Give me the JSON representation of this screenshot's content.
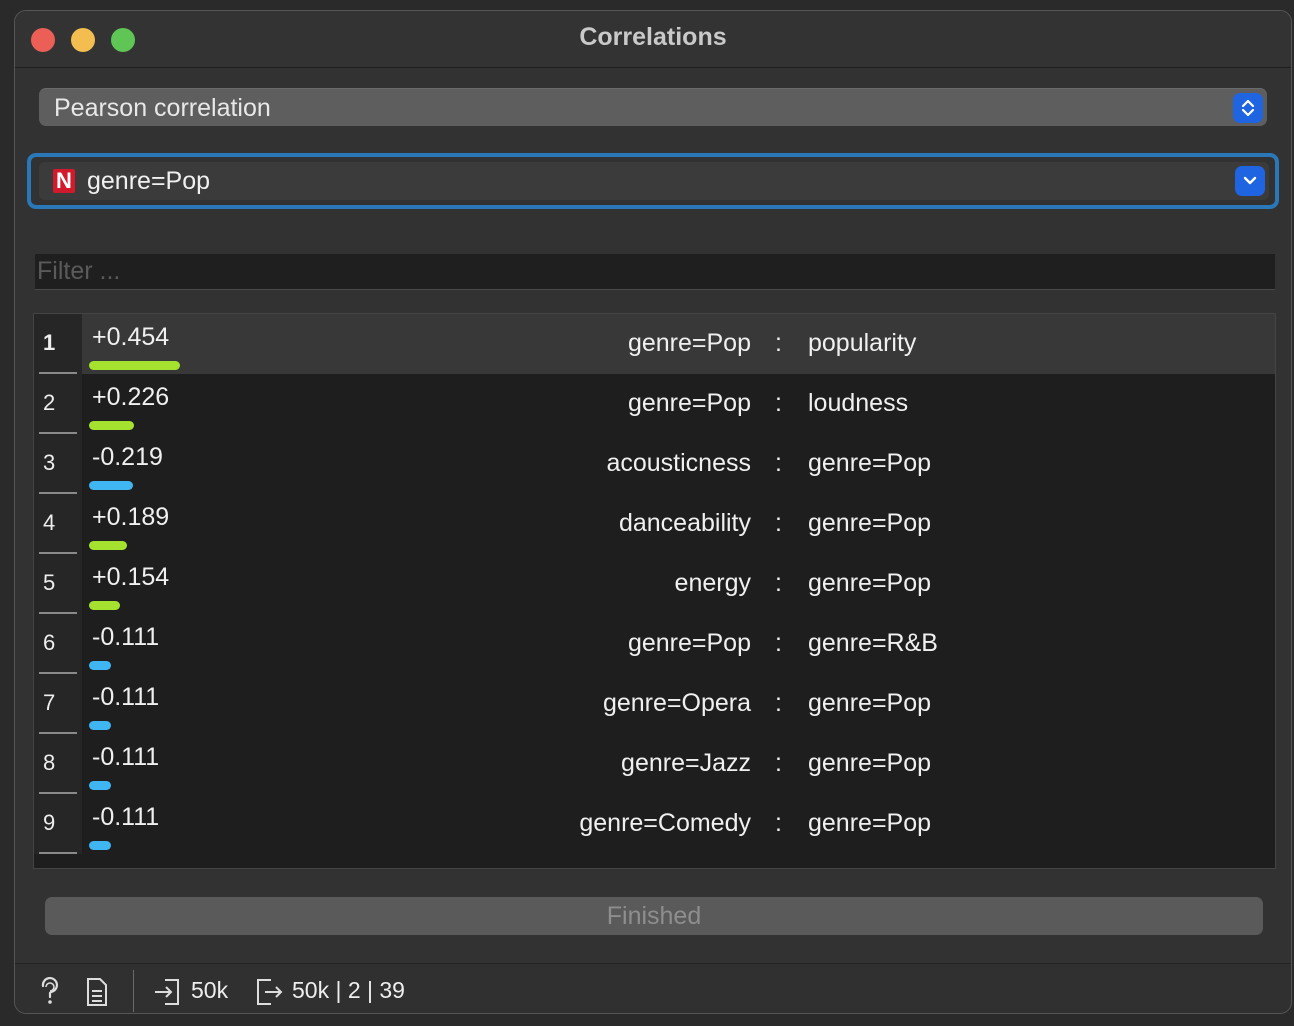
{
  "window": {
    "title": "Correlations"
  },
  "method": {
    "selected": "Pearson correlation"
  },
  "feature": {
    "type_badge": "N",
    "selected": "genre=Pop"
  },
  "filter": {
    "placeholder": "Filter ...",
    "value": ""
  },
  "colors": {
    "positive_bar": "#a4e22f",
    "negative_bar": "#3fb6f2",
    "accent": "#1f64e0",
    "focus_ring": "#2a78b8",
    "badge": "#d11b2c"
  },
  "table": {
    "rows": [
      {
        "index": "1",
        "value": 0.454,
        "value_text": "+0.454",
        "attr1": "genre=Pop",
        "sep": ":",
        "attr2": "popularity",
        "selected": true
      },
      {
        "index": "2",
        "value": 0.226,
        "value_text": "+0.226",
        "attr1": "genre=Pop",
        "sep": ":",
        "attr2": "loudness"
      },
      {
        "index": "3",
        "value": -0.219,
        "value_text": "-0.219",
        "attr1": "acousticness",
        "sep": ":",
        "attr2": "genre=Pop"
      },
      {
        "index": "4",
        "value": 0.189,
        "value_text": "+0.189",
        "attr1": "danceability",
        "sep": ":",
        "attr2": "genre=Pop"
      },
      {
        "index": "5",
        "value": 0.154,
        "value_text": "+0.154",
        "attr1": "energy",
        "sep": ":",
        "attr2": "genre=Pop"
      },
      {
        "index": "6",
        "value": -0.111,
        "value_text": "-0.111",
        "attr1": "genre=Pop",
        "sep": ":",
        "attr2": "genre=R&B"
      },
      {
        "index": "7",
        "value": -0.111,
        "value_text": "-0.111",
        "attr1": "genre=Opera",
        "sep": ":",
        "attr2": "genre=Pop"
      },
      {
        "index": "8",
        "value": -0.111,
        "value_text": "-0.111",
        "attr1": "genre=Jazz",
        "sep": ":",
        "attr2": "genre=Pop"
      },
      {
        "index": "9",
        "value": -0.111,
        "value_text": "-0.111",
        "attr1": "genre=Comedy",
        "sep": ":",
        "attr2": "genre=Pop"
      }
    ]
  },
  "status": {
    "text": "Finished"
  },
  "bottom": {
    "input_count": "50k",
    "output_summary": "50k | 2 | 39",
    "icons": [
      "help-icon",
      "report-icon",
      "input-icon",
      "output-icon"
    ]
  }
}
